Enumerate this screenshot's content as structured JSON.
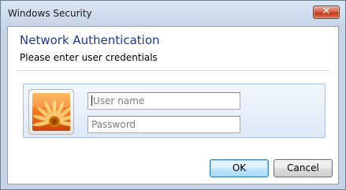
{
  "window": {
    "title": "Windows Security"
  },
  "close_button": {
    "glyph": "✕",
    "icon": "close-icon"
  },
  "dialog": {
    "heading": "Network Authentication",
    "subheading": "Please enter user credentials"
  },
  "credentials": {
    "tile_icon": "user-tile-flower-icon",
    "username": {
      "placeholder": "User name",
      "value": ""
    },
    "password": {
      "placeholder": "Password",
      "value": ""
    }
  },
  "buttons": {
    "ok_label": "OK",
    "cancel_label": "Cancel"
  },
  "colors": {
    "heading": "#1e3a8c",
    "frame": "#c5d3e5",
    "close": "#c23d20"
  }
}
